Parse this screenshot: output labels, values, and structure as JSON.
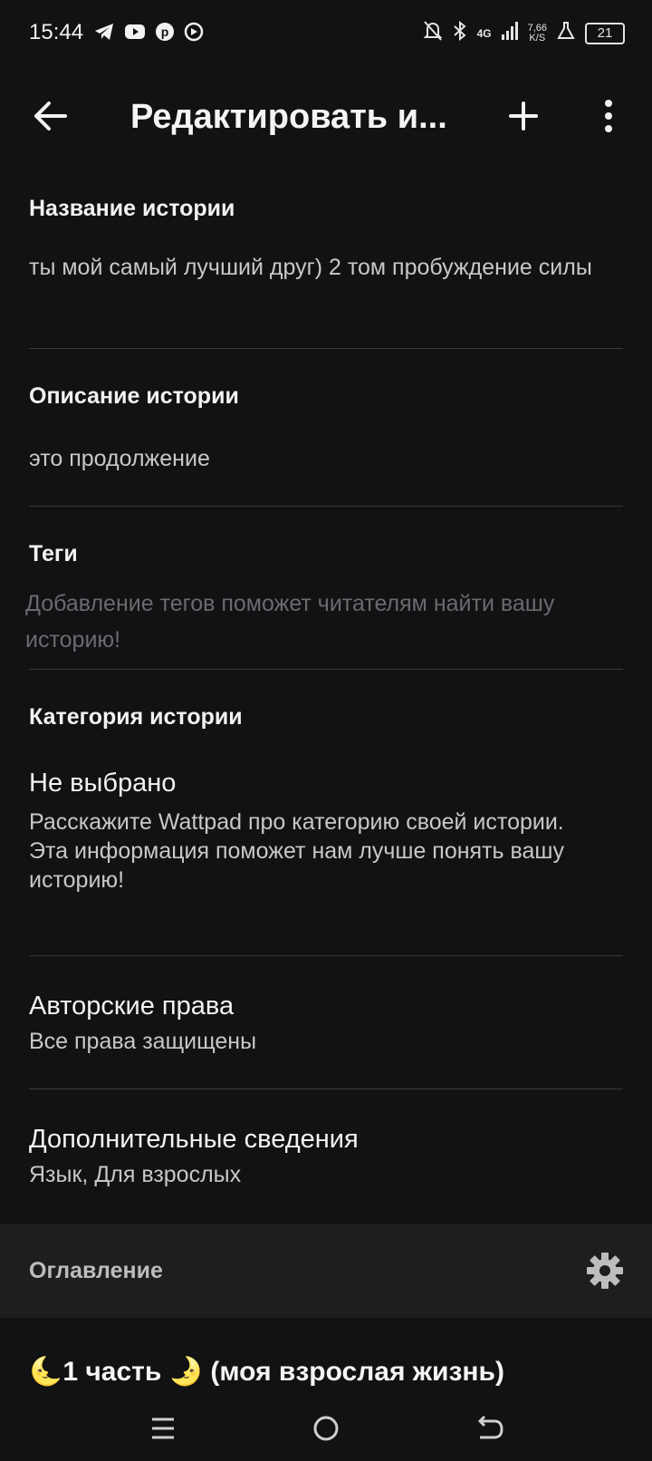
{
  "status_bar": {
    "time": "15:44",
    "left_icons": [
      "telegram-icon",
      "youtube-icon",
      "pinterest-icon",
      "media-icon"
    ],
    "network": "4G",
    "speed_value": "7,66",
    "speed_unit": "K/S",
    "battery": "21"
  },
  "header": {
    "title": "Редактировать и...",
    "back_icon": "arrow-left-icon",
    "add_icon": "plus-icon",
    "more_icon": "more-vertical-icon"
  },
  "fields": {
    "title_label": "Название истории",
    "title_value": "ты мой самый лучший друг) 2 том пробуждение силы",
    "description_label": "Описание истории",
    "description_value": "это продолжение",
    "tags_label": "Теги",
    "tags_placeholder": "Добавление тегов поможет читателям найти вашу историю!",
    "category_label": "Категория истории",
    "category_value": "Не выбрано",
    "category_hint_line1": "Расскажите Wattpad про категорию своей истории.",
    "category_hint_line2": "Эта информация поможет нам лучше понять вашу историю!",
    "copyright_label": "Авторские права",
    "copyright_value": "Все права защищены",
    "extra_label": "Дополнительные сведения",
    "extra_value": "Язык, Для взрослых"
  },
  "toc": {
    "label": "Оглавление",
    "settings_icon": "gear-icon"
  },
  "parts": [
    {
      "emoji_before": "🌜",
      "title": "1 часть",
      "emoji_after": "🌛",
      "subtitle": "(моя взрослая жизнь)"
    }
  ],
  "nav": {
    "menu_icon": "menu-icon",
    "home_icon": "home-icon",
    "back_icon": "back-icon"
  },
  "colors": {
    "background": "#121113",
    "toc_background": "#1e1d20",
    "divider": "#3a393c"
  }
}
